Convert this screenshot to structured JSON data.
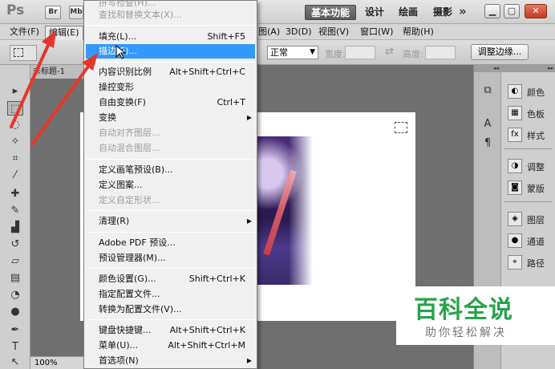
{
  "titlebar": {
    "app_logo": "Ps",
    "bridge_label": "Br",
    "minibridge_label": "Mb",
    "workspaces": [
      "基本功能",
      "设计",
      "绘画",
      "摄影"
    ],
    "more_label": "»"
  },
  "menubar": {
    "items": [
      {
        "label": "文件(F)"
      },
      {
        "label": "编辑(E)"
      },
      {
        "label": "图(A)"
      },
      {
        "label": "3D(D)"
      },
      {
        "label": "视图(V)"
      },
      {
        "label": "窗口(W)"
      },
      {
        "label": "帮助(H)"
      }
    ]
  },
  "options": {
    "mode_value": "正常",
    "width_label": "宽度:",
    "height_label": "高度:",
    "refine_edge_label": "调整边缘..."
  },
  "document": {
    "tab_label": "未标题-1",
    "zoom": "100%"
  },
  "menu": {
    "items": [
      {
        "label": "拼写检查(H)...",
        "shortcut": "",
        "disabled": true
      },
      {
        "label": "查找和替换文本(X)...",
        "shortcut": "",
        "disabled": true
      },
      {
        "label": "填充(L)...",
        "shortcut": "Shift+F5"
      },
      {
        "label": "描边(S)...",
        "shortcut": "",
        "highlight": true
      },
      {
        "label": "内容识别比例",
        "shortcut": "Alt+Shift+Ctrl+C"
      },
      {
        "label": "操控变形",
        "shortcut": ""
      },
      {
        "label": "自由变换(F)",
        "shortcut": "Ctrl+T"
      },
      {
        "label": "变换",
        "shortcut": "",
        "submenu": true
      },
      {
        "label": "自动对齐图层...",
        "shortcut": "",
        "disabled": true
      },
      {
        "label": "自动混合图层...",
        "shortcut": "",
        "disabled": true
      },
      {
        "label": "定义画笔预设(B)...",
        "shortcut": ""
      },
      {
        "label": "定义图案...",
        "shortcut": ""
      },
      {
        "label": "定义自定形状...",
        "shortcut": "",
        "disabled": true
      },
      {
        "label": "清理(R)",
        "shortcut": "",
        "submenu": true
      },
      {
        "label": "Adobe PDF 预设...",
        "shortcut": ""
      },
      {
        "label": "预设管理器(M)...",
        "shortcut": ""
      },
      {
        "label": "颜色设置(G)...",
        "shortcut": "Shift+Ctrl+K"
      },
      {
        "label": "指定配置文件...",
        "shortcut": ""
      },
      {
        "label": "转换为配置文件(V)...",
        "shortcut": ""
      },
      {
        "label": "键盘快捷键...",
        "shortcut": "Alt+Shift+Ctrl+K"
      },
      {
        "label": "菜单(U)...",
        "shortcut": "Alt+Shift+Ctrl+M"
      },
      {
        "label": "首选项(N)",
        "shortcut": "",
        "submenu": true
      }
    ]
  },
  "panels": {
    "items": [
      {
        "label": "颜色",
        "icon": "color-icon"
      },
      {
        "label": "色板",
        "icon": "swatches-icon"
      },
      {
        "label": "样式",
        "icon": "styles-icon"
      },
      {
        "label": "调整",
        "icon": "adjustments-icon"
      },
      {
        "label": "蒙版",
        "icon": "masks-icon"
      },
      {
        "label": "图层",
        "icon": "layers-icon"
      },
      {
        "label": "通道",
        "icon": "channels-icon"
      },
      {
        "label": "路径",
        "icon": "paths-icon"
      }
    ]
  },
  "watermark": {
    "main": "百科全说",
    "sub": "助你轻松解决"
  },
  "colors": {
    "highlight": "#3399ff",
    "annotation": "#e8352a",
    "watermark": "#27a34a"
  }
}
